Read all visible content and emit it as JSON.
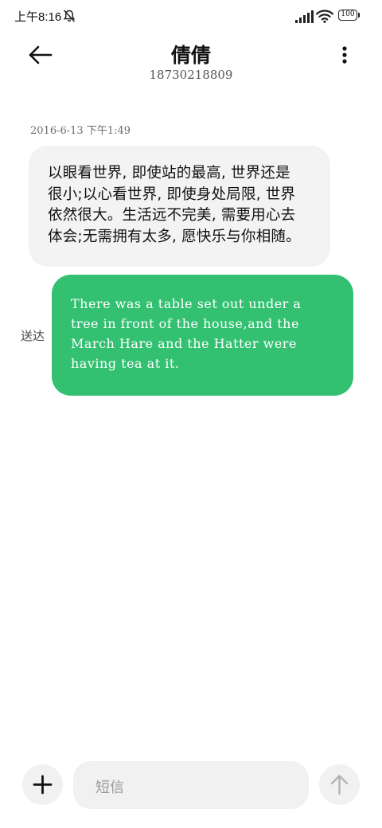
{
  "status_bar": {
    "time": "上午8:16",
    "battery": "100"
  },
  "header": {
    "contact_name": "倩倩",
    "contact_number": "18730218809"
  },
  "messages": {
    "timestamp": "2016-6-13 下午1:49",
    "incoming": {
      "lines": [
        "以眼看世界, 即使站的最高, 世界还是",
        "很小;以心看世界, 即使身处局限, 世界",
        "依然很大。生活远不完美, 需要用心去",
        "体会;无需拥有太多, 愿快乐与你相随。"
      ]
    },
    "outgoing": {
      "lines": [
        "There was a table set out under a",
        "tree in front of the house,and the",
        "March Hare and the Hatter were",
        "having tea at it."
      ],
      "status": "送达",
      "color": "#33c171"
    }
  },
  "composer": {
    "placeholder": "短信",
    "add_icon": "plus-icon",
    "send_icon": "arrow-up-icon"
  }
}
